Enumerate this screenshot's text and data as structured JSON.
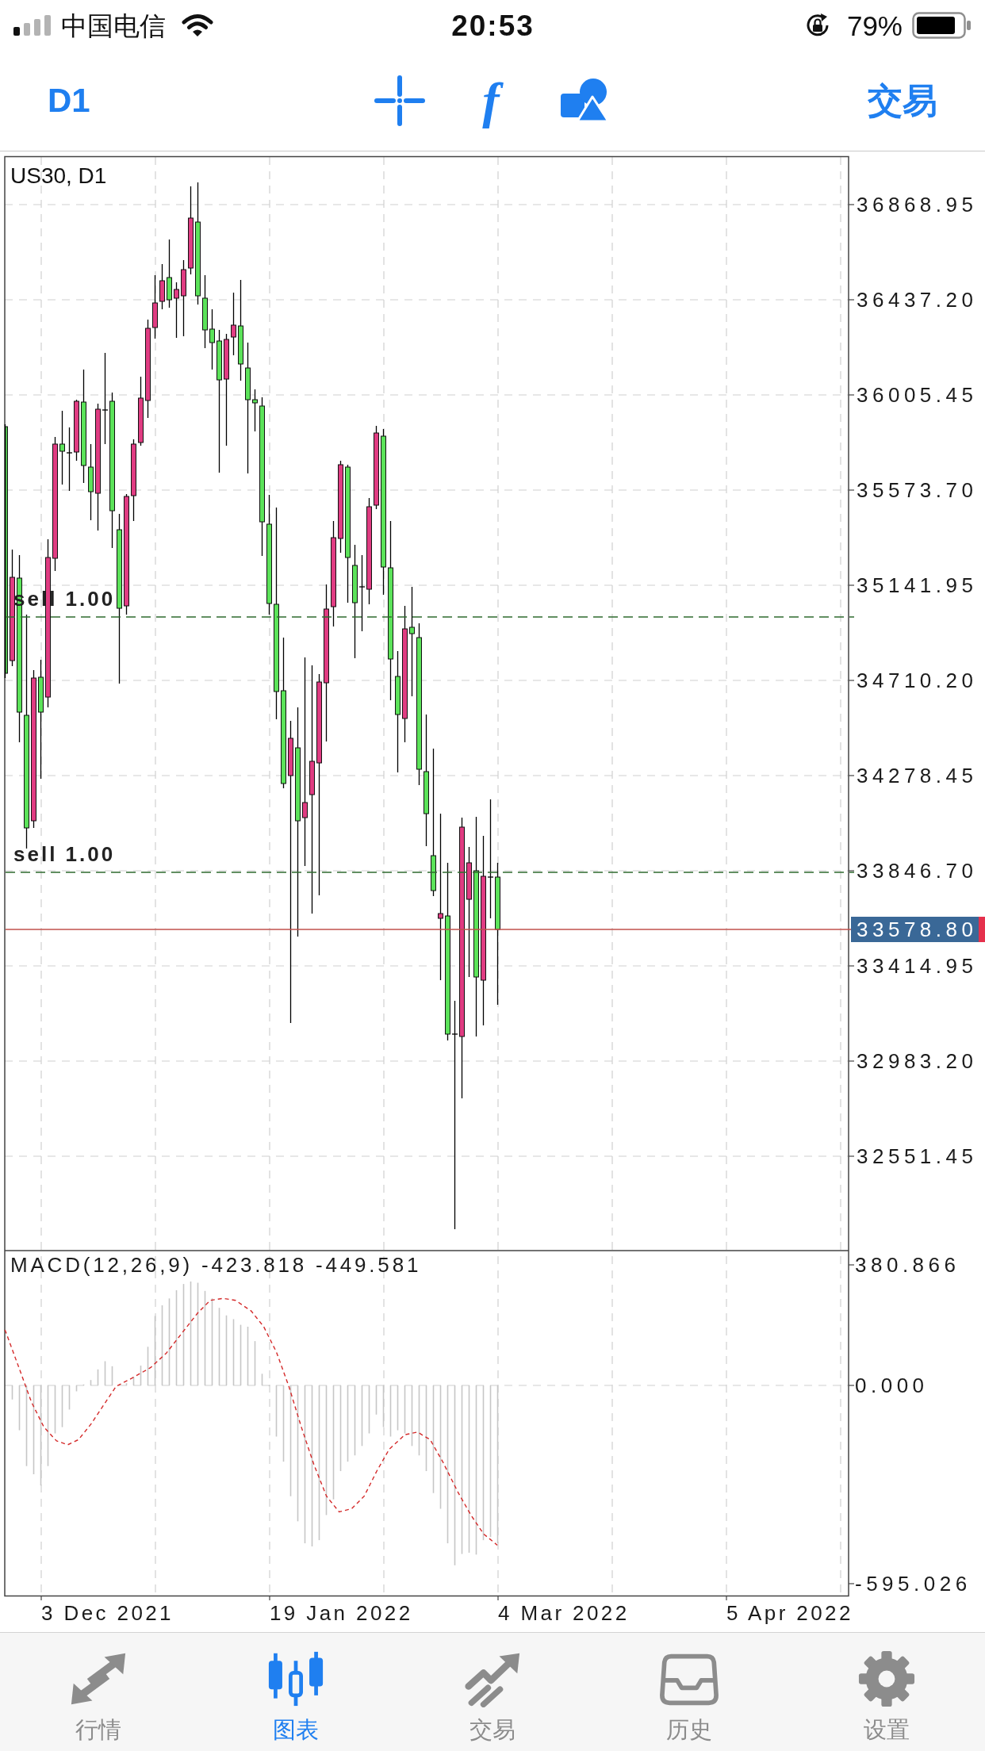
{
  "status_bar": {
    "carrier": "中国电信",
    "time": "20:53",
    "battery": "79%"
  },
  "toolbar": {
    "timeframe": "D1",
    "indicator": "f",
    "trade": "交易"
  },
  "chart": {
    "symbol": "US30, D1",
    "price_ticks": [
      "36868.95",
      "36437.20",
      "36005.45",
      "35573.70",
      "35141.95",
      "34710.20",
      "34278.45",
      "33846.70",
      "33414.95",
      "32983.20",
      "32551.45"
    ],
    "current_price": "33578.80",
    "orders": [
      {
        "label": "sell 1.00"
      },
      {
        "label": "sell 1.00"
      }
    ],
    "indicator": {
      "label": "MACD(12,26,9) -423.818 -449.581",
      "ticks": [
        "380.866",
        "0.000",
        "-595.026"
      ]
    },
    "dates": [
      "3 Dec 2021",
      "19 Jan 2022",
      "4 Mar 2022",
      "5 Apr 2022"
    ]
  },
  "tabs": [
    {
      "label": "行情",
      "selected": false
    },
    {
      "label": "图表",
      "selected": true
    },
    {
      "label": "交易",
      "selected": false
    },
    {
      "label": "历史",
      "selected": false
    },
    {
      "label": "设置",
      "selected": false
    }
  ]
}
